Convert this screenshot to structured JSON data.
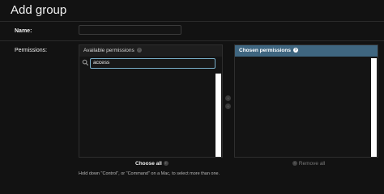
{
  "page": {
    "title": "Add group"
  },
  "form": {
    "name_label": "Name:",
    "name_value": "",
    "permissions_label": "Permissions:"
  },
  "available": {
    "title": "Available permissions",
    "filter_value": "access",
    "filter_icon": "search-icon",
    "choose_all_label": "Choose all"
  },
  "chosen": {
    "title": "Chosen permissions",
    "remove_all_label": "Remove all"
  },
  "help_text": "Hold down \"Control\", or \"Command\" on a Mac, to select more than one.",
  "colors": {
    "background": "#121212",
    "chosen_header": "#3f6680",
    "filter_border": "#79aec8"
  }
}
